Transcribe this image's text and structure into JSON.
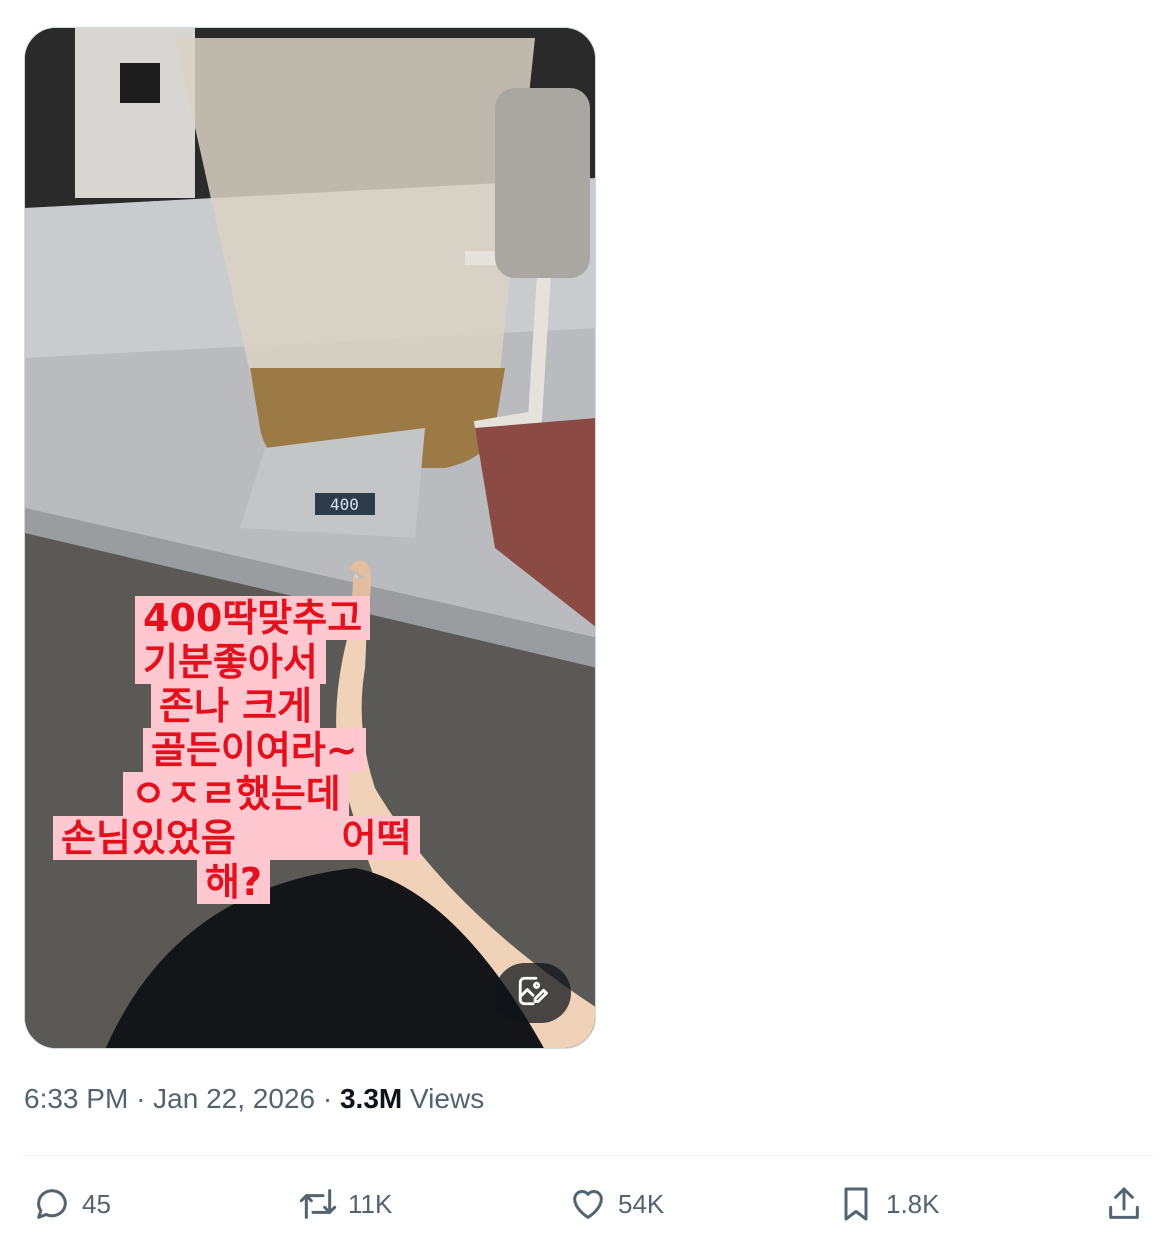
{
  "media": {
    "caption_lines": [
      "400딱맞추고",
      "기분좋아서",
      "존나 크게",
      "골든이여라~",
      "ㅇㅈㄹ했는데",
      "손님있었음        어떡",
      "해?"
    ],
    "scale_reading": "400",
    "edit_icon": "image-edit-icon"
  },
  "meta": {
    "time": "6:33 PM",
    "sep1": "·",
    "date": "Jan 22, 2026",
    "sep2": "·",
    "views_count": "3.3M",
    "views_label": "Views"
  },
  "actions": {
    "replies": "45",
    "retweets": "11K",
    "likes": "54K",
    "bookmarks": "1.8K"
  }
}
